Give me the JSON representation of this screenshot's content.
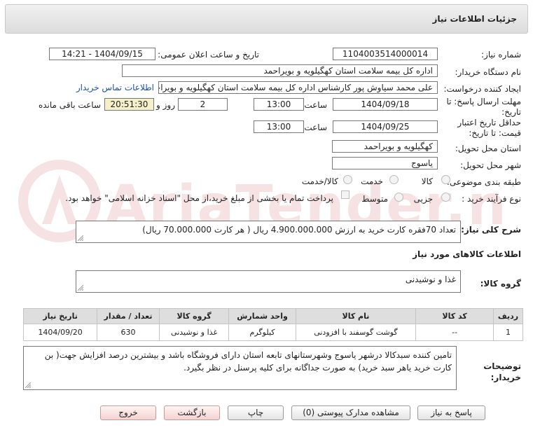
{
  "header": {
    "title": "جزئیات اطلاعات نیاز"
  },
  "form": {
    "need_number": {
      "label": "شماره نیاز:",
      "value": "1104003514000014"
    },
    "announce_datetime": {
      "label": "تاریخ و ساعت اعلان عمومی:",
      "value": "1404/09/15 - 14:21"
    },
    "buyer_org": {
      "label": "نام دستگاه خریدار:",
      "value": "اداره کل بیمه سلامت استان کهگیلویه و بویراحمد"
    },
    "requester": {
      "label": "ایجاد کننده درخواست:",
      "value": "علی محمد سیاوش پور کارشناس اداره کل بیمه سلامت استان کهگیلویه و بویراحمد",
      "contact_link": "اطلاعات تماس خریدار"
    },
    "response_deadline": {
      "label_line1": "مهلت ارسال پاسخ: تا",
      "label_line2": "تاریخ:",
      "date": "1404/09/18",
      "time_label": "ساعت",
      "time": "13:00",
      "days": "2",
      "days_label": "روز و",
      "remaining_time": "20:51:30",
      "remaining_label": "ساعت باقی مانده"
    },
    "price_validity": {
      "label_line1": "حداقل تاریخ اعتبار",
      "label_line2": "قیمت: تا تاریخ:",
      "date": "1404/09/25",
      "time_label": "ساعت",
      "time": "13:00"
    },
    "delivery_province": {
      "label": "استان محل تحویل:",
      "value": "کهگیلویه و بویراحمد"
    },
    "delivery_city": {
      "label": "شهر محل تحویل:",
      "value": "یاسوج"
    },
    "category": {
      "label": "طبقه بندی موضوعی:",
      "options": [
        "کالا",
        "خدمت",
        "کالا/خدمت"
      ]
    },
    "purchase_type": {
      "label": "نوع فرآیند خرید :",
      "options": [
        "جزیی",
        "متوسط"
      ],
      "treasury_note": "پرداخت تمام یا بخشی از مبلغ خرید،از محل \"اسناد خزانه اسلامی\" خواهد بود."
    }
  },
  "summary": {
    "label": "شرح کلی نیاز:",
    "value": "تعداد 70فقره کارت خرید به ارزش 4.900.000.000 ریال ( هر کارت 70.000.000 ریال)"
  },
  "goods_info": {
    "title": "اطلاعات کالاهای مورد نیاز"
  },
  "goods_group": {
    "label": "گروه کالا:",
    "value": "غذا و نوشیدنی"
  },
  "table": {
    "headers": [
      "ردیف",
      "کد کالا",
      "نام کالا",
      "واحد شمارش",
      "گروه کالا",
      "تعداد / مقدار",
      "تاریخ نیاز"
    ],
    "rows": [
      [
        "1",
        "--",
        "گوشت گوسفند با افزودنی",
        "کیلوگرم",
        "غذا و نوشیدنی",
        "630",
        "1404/09/20"
      ]
    ]
  },
  "buyer_notes": {
    "label_line1": "توضیحات",
    "label_line2": "خریدار:",
    "value": "تامین کننده سبدکالا درشهر یاسوج وشهرستانهای تابعه استان دارای فروشگاه باشد و بیشترین درصد افزایش جهت( بن کارت خرید یاهر سبد خرید) به صورت جداگانه برای کلیه پرسنل در نظر بگیرد."
  },
  "buttons": {
    "reply": "پاسخ به نیاز",
    "attachments": "مشاهده مدارک پیوستی (0)",
    "print": "چاپ",
    "back": "بازگشت",
    "exit": "خروج"
  },
  "watermark": {
    "text": "AriaTender.net"
  }
}
